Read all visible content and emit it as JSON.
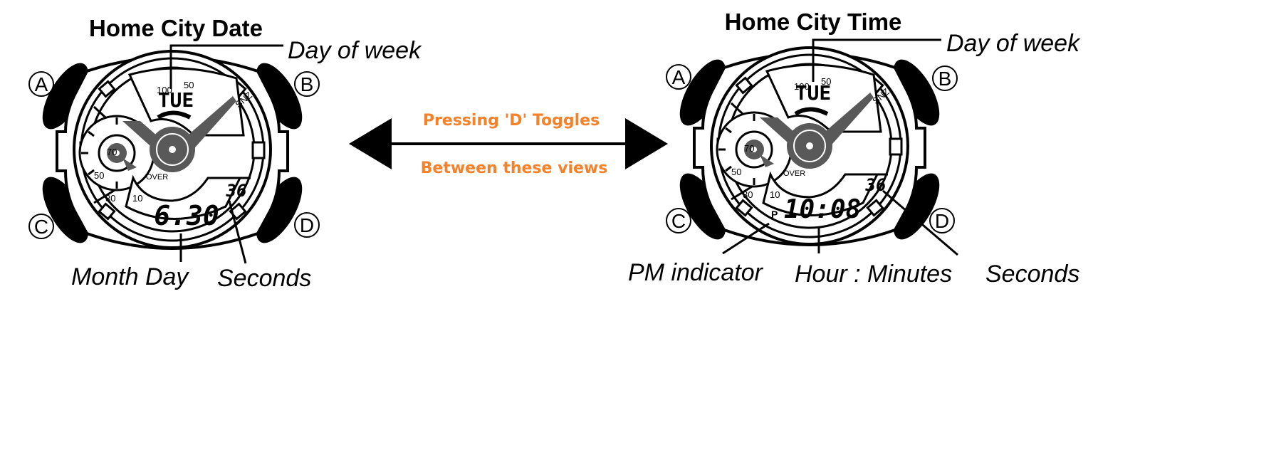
{
  "left_watch": {
    "title": "Home City Date",
    "buttons": [
      "A",
      "B",
      "C",
      "D"
    ],
    "display_day": "TUE",
    "display_main": "6.30",
    "display_seconds": "36",
    "labels": {
      "day_of_week": "Day of week",
      "month_day": "Month Day",
      "seconds": "Seconds"
    }
  },
  "right_watch": {
    "title": "Home City Time",
    "buttons": [
      "A",
      "B",
      "C",
      "D"
    ],
    "display_day": "TUE",
    "display_main": "10:08",
    "display_seconds": "36",
    "pm_mark": "P",
    "labels": {
      "day_of_week": "Day of week",
      "pm_indicator": "PM indicator",
      "hour_minutes": "Hour : Minutes",
      "seconds": "Seconds"
    }
  },
  "dial_marks": {
    "top_scale": [
      "100",
      "50"
    ],
    "snz": "SNZ",
    "sub_dial": [
      "70",
      "50",
      "30",
      "10"
    ],
    "over": "OVER"
  },
  "caption": {
    "line1": "Pressing 'D' Toggles",
    "line2": "Between these views"
  },
  "colors": {
    "caption": "#f5822a",
    "hands": "#595959",
    "ink": "#000000"
  }
}
